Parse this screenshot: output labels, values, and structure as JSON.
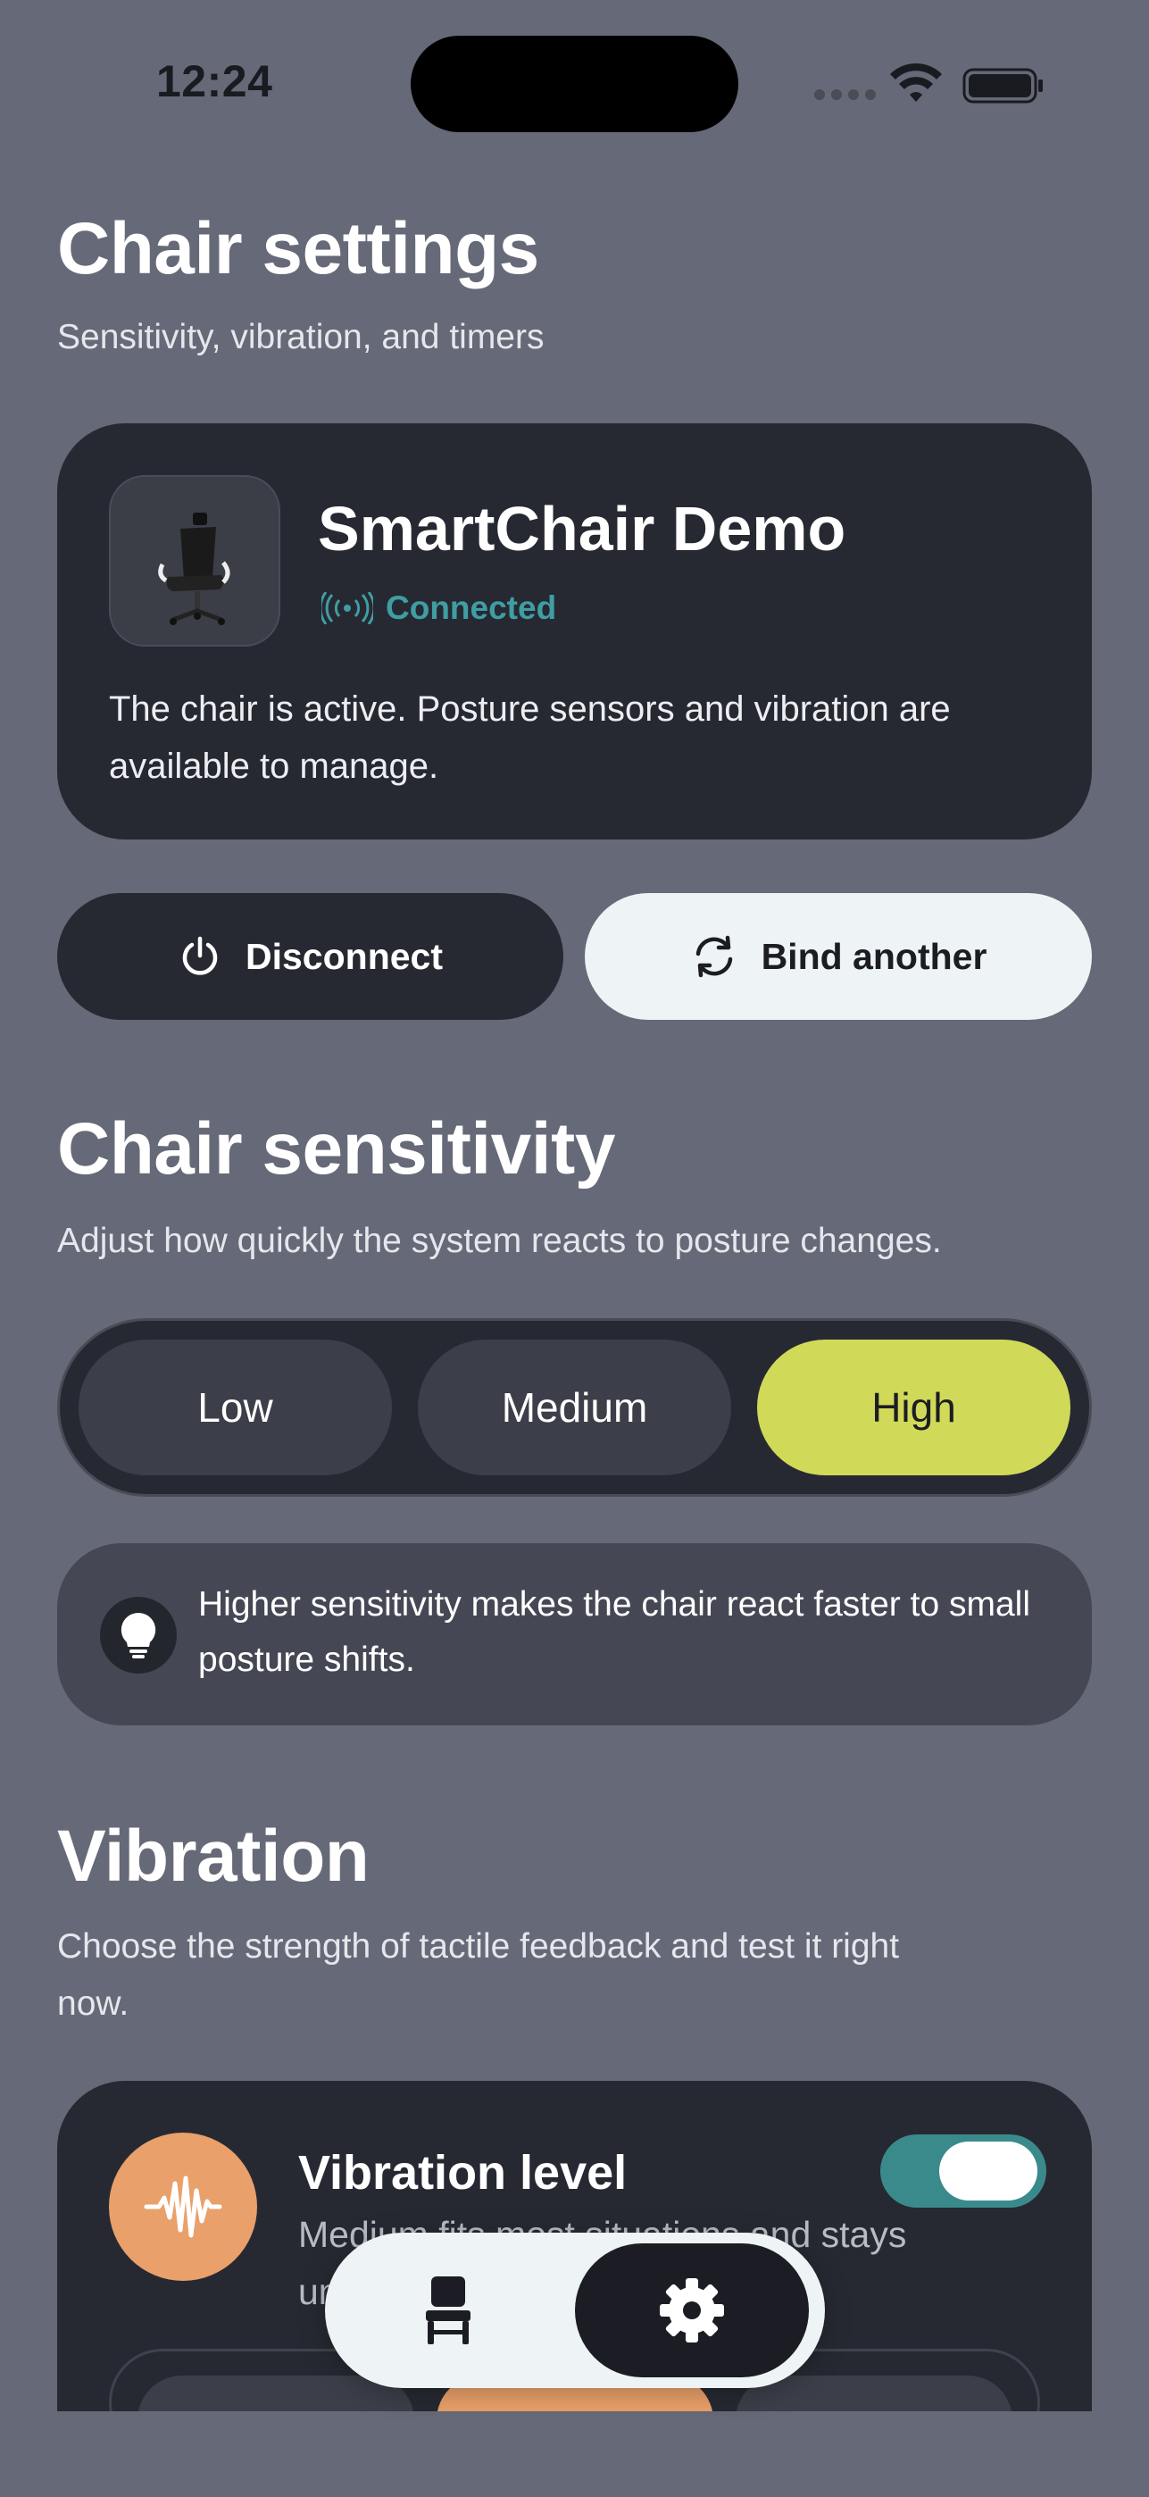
{
  "status_bar": {
    "time": "12:24"
  },
  "header": {
    "title": "Chair settings",
    "subtitle": "Sensitivity, vibration, and timers"
  },
  "device": {
    "name": "SmartChair Demo",
    "status": "Connected",
    "description": "The chair is active. Posture sensors and vibration are available to manage.",
    "accent_color": "#3f9ea3"
  },
  "actions": {
    "disconnect_label": "Disconnect",
    "bind_label": "Bind another"
  },
  "sensitivity": {
    "title": "Chair sensitivity",
    "subtitle": "Adjust how quickly the system reacts to posture changes.",
    "options": [
      "Low",
      "Medium",
      "High"
    ],
    "selected": "High",
    "selected_color": "#d0da58",
    "tip": "Higher sensitivity makes the chair react faster to small posture shifts."
  },
  "vibration": {
    "title": "Vibration",
    "subtitle": "Choose the strength of tactile feedback and test it right now.",
    "card_title": "Vibration level",
    "card_desc": "Medium fits most situations and stays unobtrusive.",
    "enabled": true,
    "accent_color": "#e9a06a"
  },
  "tabbar": {
    "items": [
      {
        "icon": "chair-icon",
        "active": false
      },
      {
        "icon": "gear-icon",
        "active": true
      }
    ]
  }
}
